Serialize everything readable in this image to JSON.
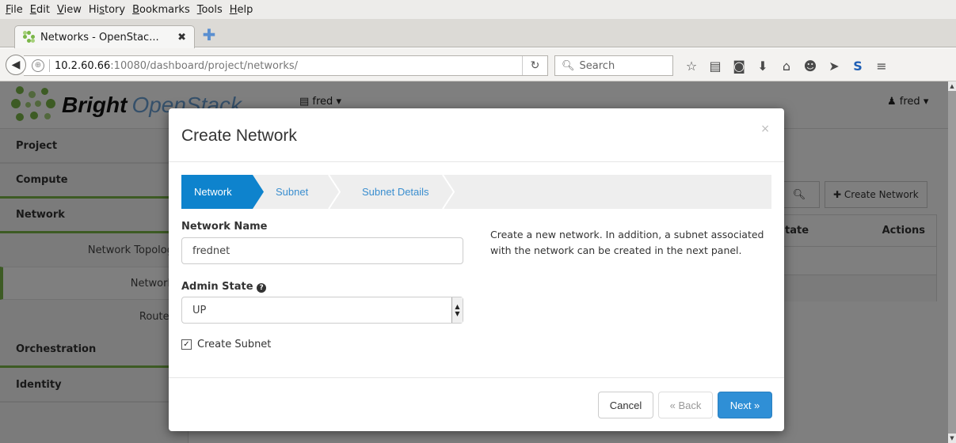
{
  "browser": {
    "menu": [
      "File",
      "Edit",
      "View",
      "History",
      "Bookmarks",
      "Tools",
      "Help"
    ],
    "menu_underline": [
      "F",
      "E",
      "V",
      "s",
      "B",
      "T",
      "H"
    ],
    "tab_title": "Networks - OpenStac...",
    "tab_close": "✖",
    "url_host": "10.2.60.66",
    "url_rest": ":10080/dashboard/project/networks/",
    "search_placeholder": "Search"
  },
  "header": {
    "brand_bold": "Bright",
    "brand_light": "OpenStack",
    "project": "fred",
    "user": "fred"
  },
  "sidebar": {
    "sections": [
      "Project",
      "Compute",
      "Network",
      "Orchestration",
      "Identity"
    ],
    "network_items": [
      "Network Topolog",
      "Network",
      "Router"
    ]
  },
  "content": {
    "create_network_button": "Create Network",
    "table_headers": [
      "tate",
      "Actions"
    ]
  },
  "modal": {
    "title": "Create Network",
    "close": "×",
    "steps": [
      "Network",
      "Subnet",
      "Subnet Details"
    ],
    "network_name_label": "Network Name",
    "network_name_value": "frednet",
    "admin_state_label": "Admin State",
    "admin_state_value": "UP",
    "create_subnet_label": "Create Subnet",
    "create_subnet_checked": true,
    "description": "Create a new network. In addition, a subnet associated with the network can be created in the next panel.",
    "cancel": "Cancel",
    "back": "« Back",
    "next": "Next »"
  },
  "colors": {
    "accent_green": "#7ab648",
    "wizard_active": "#0e83cd",
    "primary_button": "#2f8fd6"
  }
}
